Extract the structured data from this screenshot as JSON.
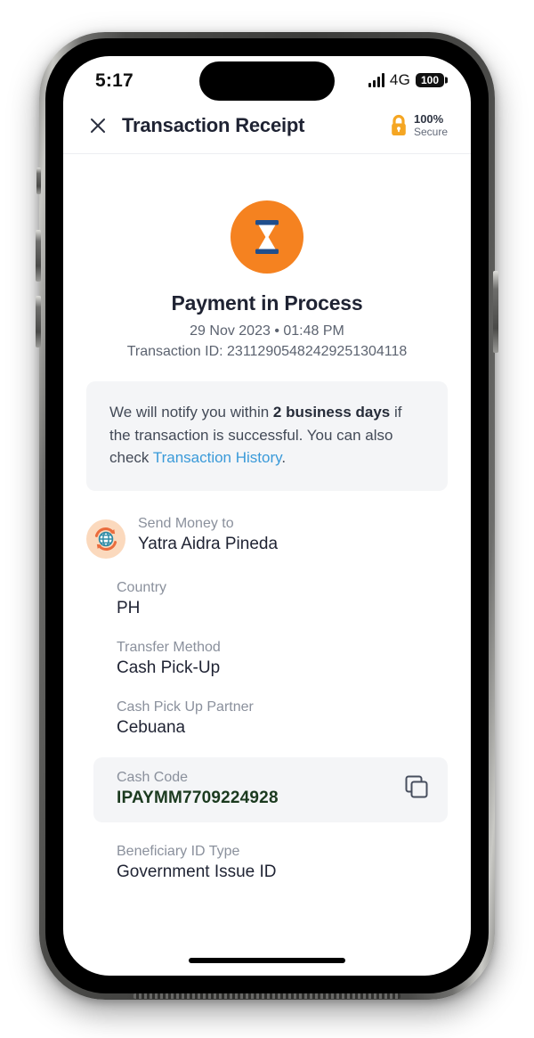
{
  "status_bar": {
    "time": "5:17",
    "network": "4G",
    "battery": "100",
    "signal_icon": "signal-bars-icon"
  },
  "header": {
    "close_icon": "close-x-icon",
    "title": "Transaction Receipt",
    "secure_lock_icon": "lock-icon",
    "secure_percent": "100%",
    "secure_label": "Secure"
  },
  "status": {
    "icon": "hourglass-icon",
    "title": "Payment in Process",
    "date": "29 Nov 2023 • 01:48 PM",
    "transaction_id": "Transaction ID: 23112905482429251304118"
  },
  "notify": {
    "part1": "We will notify you within ",
    "bold1": "2 business days",
    "part2": " if the transaction is successful. You can also check ",
    "link": "Transaction History",
    "part3": "."
  },
  "recipient": {
    "icon": "globe-transfer-icon",
    "label": "Send Money to",
    "value": "Yatra Aidra Pineda"
  },
  "details": [
    {
      "label": "Country",
      "value": "PH"
    },
    {
      "label": "Transfer Method",
      "value": "Cash Pick-Up"
    },
    {
      "label": "Cash Pick Up Partner",
      "value": "Cebuana"
    }
  ],
  "cash_code": {
    "label": "Cash Code",
    "value": "IPAYMM7709224928",
    "copy_icon": "copy-icon"
  },
  "beneficiary": {
    "label": "Beneficiary ID Type",
    "value": "Government Issue ID"
  },
  "colors": {
    "accent_orange": "#F58220",
    "hourglass_navy": "#1F4E8C",
    "link_blue": "#3A9AD9",
    "lock_amber": "#F5A623",
    "code_green": "#1B3A1F",
    "panel_gray": "#F4F5F7"
  }
}
